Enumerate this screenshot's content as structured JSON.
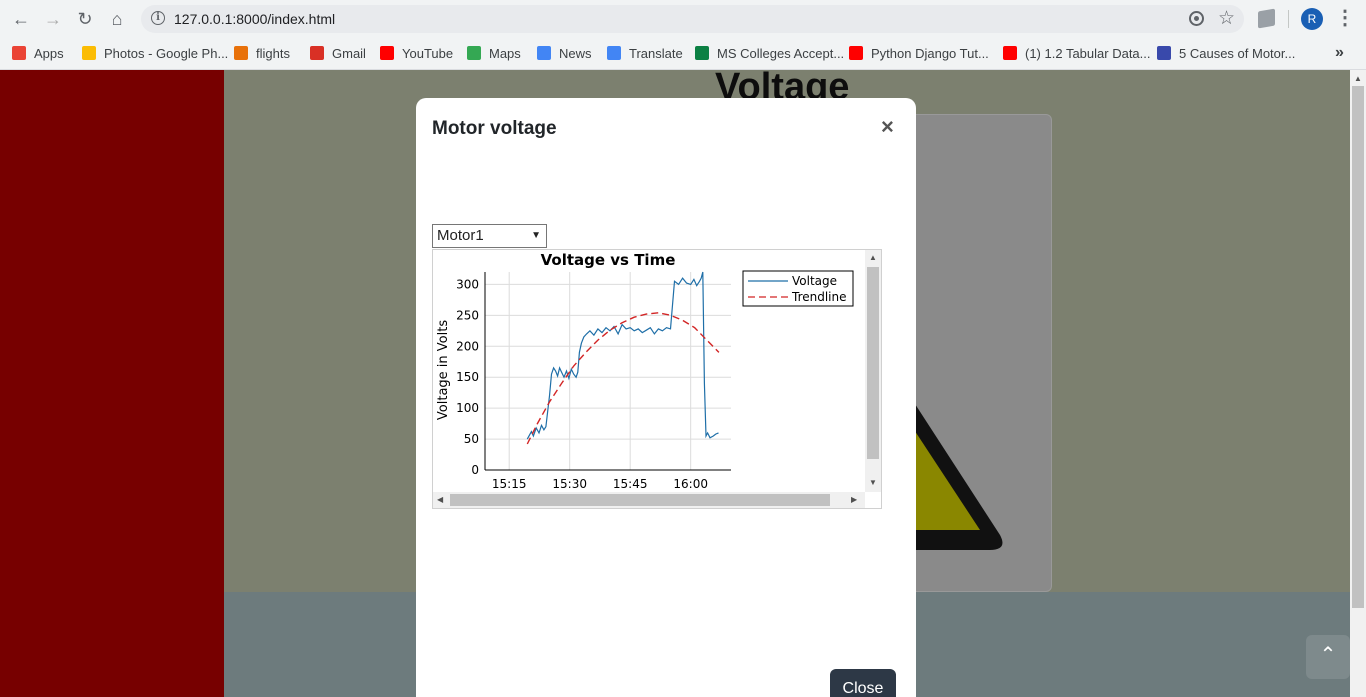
{
  "browser": {
    "url": "127.0.0.1:8000/index.html",
    "avatar_letter": "R",
    "bookmarks": [
      {
        "label": "Apps",
        "color": "#ea4335"
      },
      {
        "label": "Photos - Google Ph...",
        "color": "#fbbc04"
      },
      {
        "label": "flights",
        "color": "#e8710a"
      },
      {
        "label": "Gmail",
        "color": "#d93025"
      },
      {
        "label": "YouTube",
        "color": "#ff0000"
      },
      {
        "label": "Maps",
        "color": "#34a853"
      },
      {
        "label": "News",
        "color": "#4285f4"
      },
      {
        "label": "Translate",
        "color": "#4285f4"
      },
      {
        "label": "MS Colleges Accept...",
        "color": "#0b8043"
      },
      {
        "label": "Python Django Tut...",
        "color": "#ff0000"
      },
      {
        "label": "(1) 1.2 Tabular Data...",
        "color": "#ff0000"
      },
      {
        "label": "5 Causes of Motor...",
        "color": "#3949ab"
      }
    ]
  },
  "page": {
    "heading": "Voltage"
  },
  "modal": {
    "title": "Motor voltage",
    "close_x": "×",
    "motor_select": "Motor1",
    "close_label": "Close"
  },
  "chart_data": {
    "type": "line",
    "title": "Voltage vs Time",
    "xlabel": "",
    "ylabel": "Voltage in Volts",
    "x_ticks": [
      "15:15",
      "15:30",
      "15:45",
      "16:00"
    ],
    "x_tick_minutes": [
      915,
      930,
      945,
      960
    ],
    "xlim_minutes": [
      909,
      970
    ],
    "ylim": [
      0,
      320
    ],
    "y_ticks": [
      0,
      50,
      100,
      150,
      200,
      250,
      300
    ],
    "grid": true,
    "legend_position": "top-right (outside plot)",
    "series": [
      {
        "name": "Voltage",
        "color": "#1f6fa8",
        "style": "solid",
        "x_minutes": [
          919.5,
          920.5,
          921.0,
          921.7,
          922.4,
          923.0,
          923.6,
          924.1,
          924.6,
          925.0,
          925.5,
          926.0,
          926.5,
          927.0,
          927.5,
          928.0,
          928.6,
          929.2,
          929.8,
          930.4,
          931.0,
          931.6,
          932.0,
          932.4,
          932.9,
          933.5,
          934.2,
          935.0,
          936.0,
          937.0,
          938.0,
          939.0,
          940.0,
          941.0,
          942.0,
          943.0,
          944.0,
          945.0,
          946.0,
          947.0,
          948.0,
          949.0,
          950.0,
          951.0,
          952.0,
          953.0,
          954.0,
          955.0,
          956.0,
          957.0,
          958.0,
          959.0,
          960.0,
          960.8,
          961.5,
          962.2,
          962.6,
          963.0,
          963.4,
          963.8,
          964.2,
          964.8,
          965.6,
          966.2,
          966.9
        ],
        "values": [
          50,
          62,
          55,
          68,
          60,
          72,
          65,
          70,
          98,
          120,
          155,
          165,
          160,
          152,
          165,
          158,
          150,
          160,
          148,
          163,
          155,
          150,
          158,
          190,
          205,
          215,
          220,
          225,
          218,
          228,
          222,
          230,
          225,
          232,
          220,
          235,
          228,
          230,
          225,
          228,
          222,
          226,
          230,
          220,
          228,
          225,
          230,
          228,
          305,
          300,
          310,
          302,
          300,
          308,
          298,
          305,
          310,
          320,
          140,
          55,
          60,
          52,
          55,
          58,
          60
        ]
      },
      {
        "name": "Trendline",
        "color": "#d22525",
        "style": "dashed",
        "x_minutes": [
          919.5,
          922,
          925,
          928,
          931,
          934,
          937,
          940,
          943,
          946,
          949,
          952,
          955,
          958,
          961,
          964,
          967
        ],
        "values": [
          42,
          75,
          110,
          140,
          168,
          190,
          210,
          226,
          238,
          247,
          252,
          254,
          250,
          242,
          230,
          210,
          190
        ]
      }
    ]
  }
}
